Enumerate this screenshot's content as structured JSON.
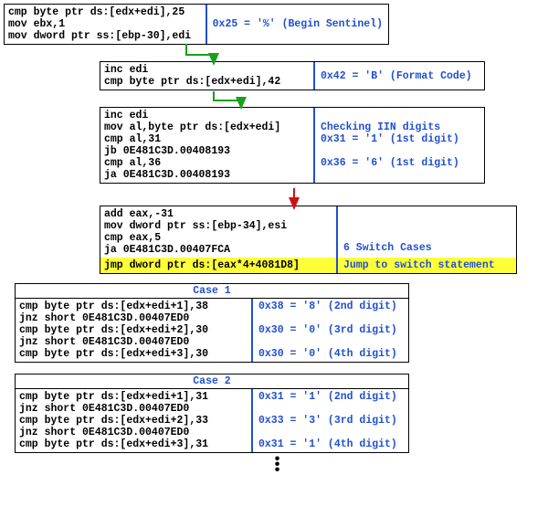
{
  "block1": {
    "code": "cmp byte ptr ds:[edx+edi],25\nmov ebx,1\nmov dword ptr ss:[ebp-30],edi",
    "comment": "0x25 = '%' (Begin Sentinel)"
  },
  "block2": {
    "code": "inc edi\ncmp byte ptr ds:[edx+edi],42",
    "comment": "0x42 = 'B' (Format Code)"
  },
  "block3": {
    "code": "inc edi\nmov al,byte ptr ds:[edx+edi]\ncmp al,31\njb 0E481C3D.00408193\ncmp al,36\nja 0E481C3D.00408193",
    "comment": "Checking IIN digits\n0x31 = '1' (1st digit)\n\n0x36 = '6' (1st digit)"
  },
  "block4": {
    "code_pre": "add eax,-31\nmov dword ptr ss:[ebp-34],esi\ncmp eax,5\nja 0E481C3D.00407FCA",
    "code_hl": "jmp dword ptr ds:[eax*4+4081D8]",
    "comment_pre": "6 Switch Cases",
    "comment_hl": "Jump to switch statement"
  },
  "case1": {
    "title": "Case 1",
    "code": "cmp byte ptr ds:[edx+edi+1],38\njnz short 0E481C3D.00407ED0\ncmp byte ptr ds:[edx+edi+2],30\njnz short 0E481C3D.00407ED0\ncmp byte ptr ds:[edx+edi+3],30",
    "comment": "0x38 = '8' (2nd digit)\n\n0x30 = '0' (3rd digit)\n\n0x30 = '0' (4th digit)"
  },
  "case2": {
    "title": "Case 2",
    "code": "cmp byte ptr ds:[edx+edi+1],31\njnz short 0E481C3D.00407ED0\ncmp byte ptr ds:[edx+edi+2],33\njnz short 0E481C3D.00407ED0\ncmp byte ptr ds:[edx+edi+3],31",
    "comment": "0x31 = '1' (2nd digit)\n\n0x33 = '3' (3rd digit)\n\n0x31 = '1' (4th digit)"
  },
  "ellipsis": "•\n•\n•"
}
